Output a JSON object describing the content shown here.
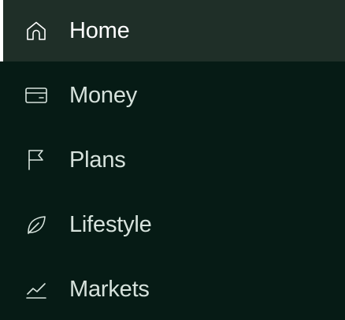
{
  "nav": {
    "items": [
      {
        "label": "Home",
        "icon": "home-icon",
        "active": true
      },
      {
        "label": "Money",
        "icon": "wallet-icon",
        "active": false
      },
      {
        "label": "Plans",
        "icon": "flag-icon",
        "active": false
      },
      {
        "label": "Lifestyle",
        "icon": "leaf-icon",
        "active": false
      },
      {
        "label": "Markets",
        "icon": "chart-line-icon",
        "active": false
      }
    ]
  },
  "colors": {
    "background": "#061b15",
    "active_background": "#1f2f28",
    "active_indicator": "#ffffff",
    "text": "#d6e2dc",
    "active_text": "#ffffff"
  }
}
